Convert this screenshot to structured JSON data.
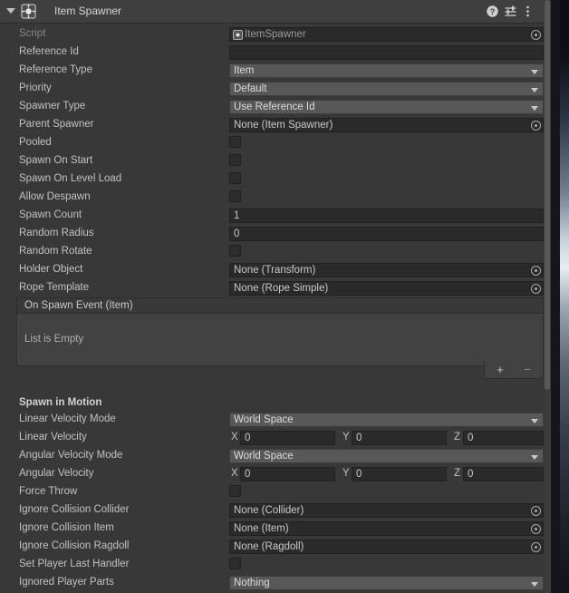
{
  "header": {
    "title": "Item Spawner",
    "icon": "script-component-icon",
    "foldout": "expanded",
    "buttons": [
      {
        "name": "help-icon",
        "label": "?"
      },
      {
        "name": "preset-icon",
        "label": ""
      },
      {
        "name": "overflow-menu-icon",
        "label": ""
      }
    ]
  },
  "colors": {
    "panel_bg": "#383838",
    "header_bg": "#3f3f3f",
    "field_dark": "#2a2a2a",
    "dropdown_bg": "#585858",
    "text": "#c2c2c2",
    "text_dim": "#8a8a8a",
    "box_bg": "#424242"
  },
  "rows": [
    {
      "label": "Script",
      "label_style": "dim",
      "type": "object",
      "value": "ItemSpawner",
      "icon": "script-icon",
      "value_dim": true
    },
    {
      "label": "Reference Id",
      "label_style": "",
      "type": "text",
      "value": ""
    },
    {
      "label": "Reference Type",
      "label_style": "",
      "type": "dropdown",
      "value": "Item"
    },
    {
      "label": "Priority",
      "label_style": "",
      "type": "dropdown",
      "value": "Default"
    },
    {
      "label": "Spawner Type",
      "label_style": "",
      "type": "dropdown",
      "value": "Use Reference Id"
    },
    {
      "label": "Parent Spawner",
      "label_style": "",
      "type": "object",
      "value": "None (Item Spawner)"
    },
    {
      "label": "Pooled",
      "label_style": "",
      "type": "checkbox",
      "value": false
    },
    {
      "label": "Spawn On Start",
      "label_style": "",
      "type": "checkbox",
      "value": false
    },
    {
      "label": "Spawn On Level Load",
      "label_style": "",
      "type": "checkbox",
      "value": false
    },
    {
      "label": "Allow Despawn",
      "label_style": "",
      "type": "checkbox",
      "value": false
    },
    {
      "label": "Spawn Count",
      "label_style": "",
      "type": "text",
      "value": "1"
    },
    {
      "label": "Random Radius",
      "label_style": "",
      "type": "text",
      "value": "0"
    },
    {
      "label": "Random Rotate",
      "label_style": "",
      "type": "checkbox",
      "value": false
    },
    {
      "label": "Holder Object",
      "label_style": "",
      "type": "object",
      "value": "None (Transform)"
    },
    {
      "label": "Rope Template",
      "label_style": "",
      "type": "object",
      "value": "None (Rope Simple)"
    }
  ],
  "event_list": {
    "title": "On Spawn Event (Item)",
    "empty_text": "List is Empty",
    "add_label": "+",
    "remove_label": "−"
  },
  "section": {
    "title": "Spawn in Motion"
  },
  "motion_rows": [
    {
      "label": "Linear Velocity Mode",
      "type": "dropdown",
      "value": "World Space"
    },
    {
      "label": "Linear Velocity",
      "type": "vector3",
      "axes": [
        "X",
        "Y",
        "Z"
      ],
      "value": [
        "0",
        "0",
        "0"
      ]
    },
    {
      "label": "Angular Velocity Mode",
      "type": "dropdown",
      "value": "World Space"
    },
    {
      "label": "Angular Velocity",
      "type": "vector3",
      "axes": [
        "X",
        "Y",
        "Z"
      ],
      "value": [
        "0",
        "0",
        "0"
      ]
    },
    {
      "label": "Force Throw",
      "type": "checkbox",
      "value": false
    },
    {
      "label": "Ignore Collision Collider",
      "type": "object",
      "value": "None (Collider)"
    },
    {
      "label": "Ignore Collision Item",
      "type": "object",
      "value": "None (Item)"
    },
    {
      "label": "Ignore Collision Ragdoll",
      "type": "object",
      "value": "None (Ragdoll)"
    },
    {
      "label": "Set Player Last Handler",
      "type": "checkbox",
      "value": false
    },
    {
      "label": "Ignored Player Parts",
      "type": "dropdown",
      "value": "Nothing"
    }
  ]
}
